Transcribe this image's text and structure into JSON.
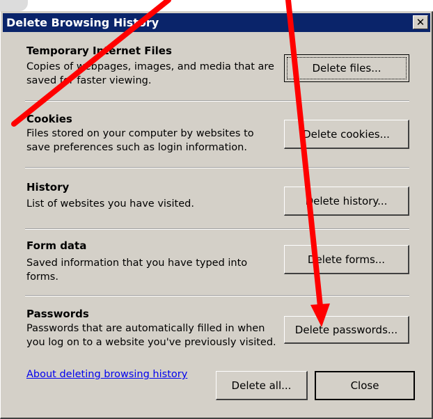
{
  "dialog": {
    "title": "Delete Browsing History",
    "close_glyph": "✕"
  },
  "sections": [
    {
      "title": "Temporary Internet Files",
      "desc": "Copies of webpages, images, and media that are saved for faster viewing.",
      "button": "Delete files..."
    },
    {
      "title": "Cookies",
      "desc": "Files stored on your computer by websites to save preferences such as login information.",
      "button": "Delete cookies..."
    },
    {
      "title": "History",
      "desc": "List of websites you have visited.",
      "button": "Delete history..."
    },
    {
      "title": "Form data",
      "desc": "Saved information that you have typed into forms.",
      "button": "Delete forms..."
    },
    {
      "title": "Passwords",
      "desc": "Passwords that are automatically filled in when you log on to a website you've previously visited.",
      "button": "Delete passwords..."
    }
  ],
  "footer": {
    "link": "About deleting browsing history",
    "delete_all": "Delete all...",
    "close": "Close"
  },
  "annotation": {
    "arrow_color": "#ff0000"
  }
}
